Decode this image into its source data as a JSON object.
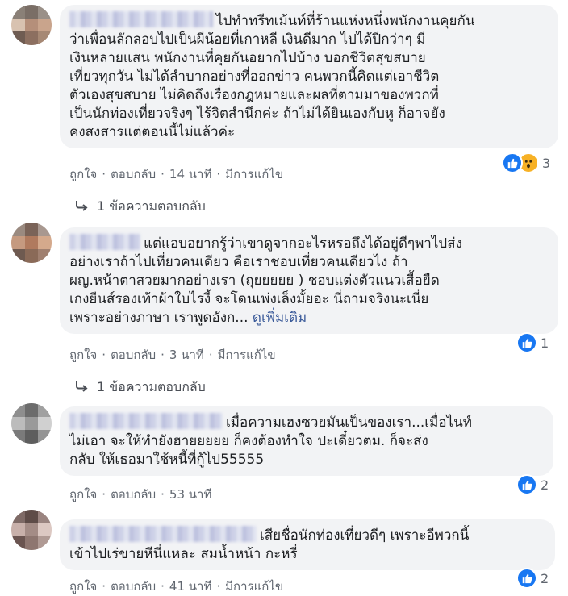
{
  "comments": [
    {
      "avatar_colors": [
        "#8a8077",
        "#7a6e66",
        "#9a9088",
        "#d8c2b0",
        "#b58f7a",
        "#c9a48c",
        "#6f5c52",
        "#8c6f60",
        "#a68874"
      ],
      "lines": [
        "ไปทำทรีทเม้นท์ที่ร้านแห่งหนึ่งพนักงานคุยกัน",
        "ว่าเพื่อนลักลอบไปเป็นผีน้อยที่เกาหลี เงินดีมาก ไปได้ปีกว่าๆ มี",
        "เงินหลายแสน พนักงานที่คุยกันอยากไปบ้าง บอกชีวิตสุขสบาย",
        "เที่ยวทุกวัน ไม่ได้ลำบากอย่างที่ออกข่าว คนพวกนี้คิดแต่เอาชีวิต",
        "ตัวเองสุขสบาย ไม่คิดถึงเรื่องกฎหมายและผลที่ตามมาของพวกที่",
        "เป็นนักท่องเที่ยวจริงๆ ไร้จิตสำนึกค่ะ ถ้าไม่ได้ยินเองกับหู ก็อาจยัง",
        "คงสงสารแต่ตอนนี้ไม่แล้วค่ะ"
      ],
      "see_more": "",
      "like": "ถูกใจ",
      "reply": "ตอบกลับ",
      "time": "14 นาที",
      "edited": "มีการแก้ไข",
      "reaction_count": "3",
      "reply_summary": "1 ข้อความตอบกลับ"
    },
    {
      "avatar_colors": [
        "#9a8a80",
        "#7a6358",
        "#a89890",
        "#c59a80",
        "#b07a5e",
        "#d4a98c",
        "#6e5a50",
        "#8a6a58",
        "#a08070"
      ],
      "lines": [
        "แต่แอบอยากรู้ว่าเขาดูจากอะไรหรอถึงได้อยู่ดีๆพาไปส่ง",
        "อย่างเราถ้าไปเที่ยวคนเดียว คือเราชอบเที่ยวคนเดียวไง ถ้า",
        "ผญ.หน้าตาสวยมากอย่างเรา (ถุยยยยย ) ชอบแต่งตัวแนวเสื้อยืด",
        "เกงยีนส์รองเท้าผ้าใบไรงี้ จะโดนเพ่งเล็งมั้ยอะ นี่ถามจริงนะเนี่ย",
        "เพราะอย่างภาษา เราพูดอังก..."
      ],
      "see_more": "ดูเพิ่มเติม",
      "like": "ถูกใจ",
      "reply": "ตอบกลับ",
      "time": "3 นาที",
      "edited": "มีการแก้ไข",
      "reaction_count": "1",
      "reply_summary": "1 ข้อความตอบกลับ"
    },
    {
      "avatar_colors": [
        "#8e8e8e",
        "#6c6c6c",
        "#a0a0a0",
        "#bcbcbc",
        "#9a9a9a",
        "#d0d0d0",
        "#7a7a7a",
        "#5e5e5e",
        "#959595"
      ],
      "lines": [
        "เมื่อความเฮงซวยมันเป็นของเรา...เมื่อไนท์",
        "ไม่เอา จะให้ทำยังฮายยยยย ก็คงต้องทำใจ ปะเดี๋ยวตม. ก็จะส่ง",
        "กลับ ให้เธอมาใช้หนี้ที่กู้ไป55555"
      ],
      "see_more": "",
      "like": "ถูกใจ",
      "reply": "ตอบกลับ",
      "time": "53 นาที",
      "edited": "",
      "reaction_count": "2",
      "reply_summary": ""
    },
    {
      "avatar_colors": [
        "#7e6a66",
        "#5e4c48",
        "#9a8480",
        "#c8b0aa",
        "#a48c86",
        "#dcc8c2",
        "#6a5450",
        "#8e7670",
        "#b09a94"
      ],
      "lines": [
        "เสียชื่อนักท่องเที่ยวดีๆ เพราะอีพวกนี้",
        "เข้าไปเร่ขายหีนี่แหละ สมน้ำหน้า กะหรี่"
      ],
      "see_more": "",
      "like": "ถูกใจ",
      "reply": "ตอบกลับ",
      "time": "41 นาที",
      "edited": "มีการแก้ไข",
      "reaction_count": "2",
      "reply_summary": ""
    }
  ],
  "colors": {
    "like_blue": "#1877f2",
    "link_blue": "#385898",
    "bubble_bg": "#f2f3f5",
    "meta_gray": "#616770"
  }
}
